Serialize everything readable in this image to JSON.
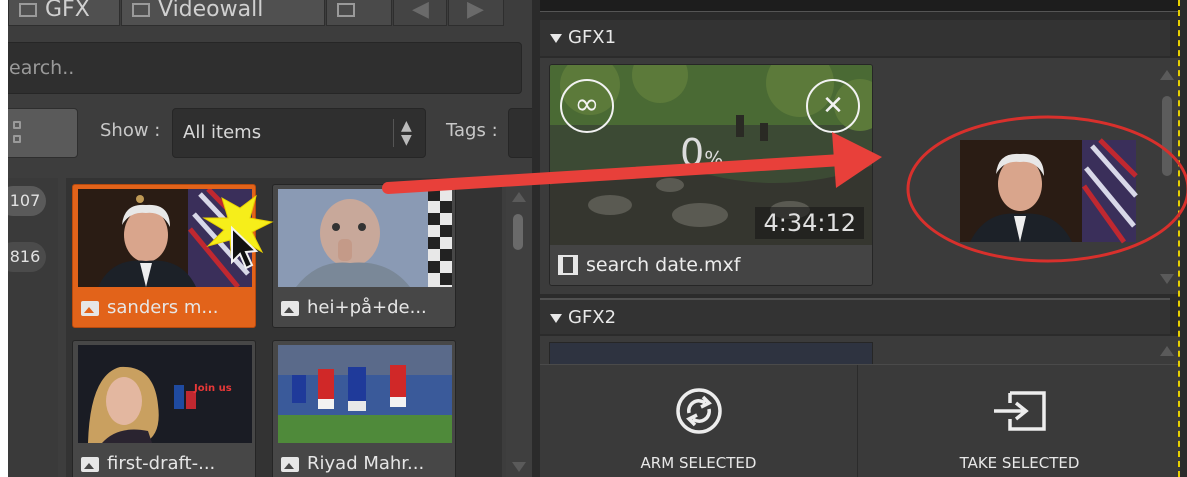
{
  "left_panel": {
    "tabs": [
      {
        "label": "GFX"
      },
      {
        "label": "Videowall"
      }
    ],
    "search": {
      "placeholder": "earch.."
    },
    "filters": {
      "show_label": "Show :",
      "show_value": "All items",
      "tags_label": "Tags :"
    },
    "counts": [
      "107",
      "816"
    ],
    "media_items": [
      {
        "name": "sanders m...",
        "selected": true,
        "icon": "image-icon"
      },
      {
        "name": "hei+på+de...",
        "selected": false,
        "icon": "image-icon"
      },
      {
        "name": "first-draft-...",
        "selected": false,
        "icon": "image-icon"
      },
      {
        "name": "Riyad Mahr...",
        "selected": false,
        "icon": "image-icon"
      }
    ]
  },
  "right_panel": {
    "layers": [
      {
        "name": "GFX1",
        "clip": {
          "progress_value": "0",
          "progress_unit": "%",
          "timecode": "4:34:12",
          "name": "search date.mxf",
          "loop_icon": "infinity-icon",
          "close_icon": "close-icon"
        }
      },
      {
        "name": "GFX2"
      }
    ],
    "actions": {
      "arm_label": "ARM SELECTED",
      "take_label": "TAKE SELECTED"
    }
  },
  "annotation": {
    "arrow_color": "#e8403a",
    "ellipse_color": "#d8302c",
    "highlight_color": "#e2631a",
    "burst_color": "#f6ee1a"
  }
}
